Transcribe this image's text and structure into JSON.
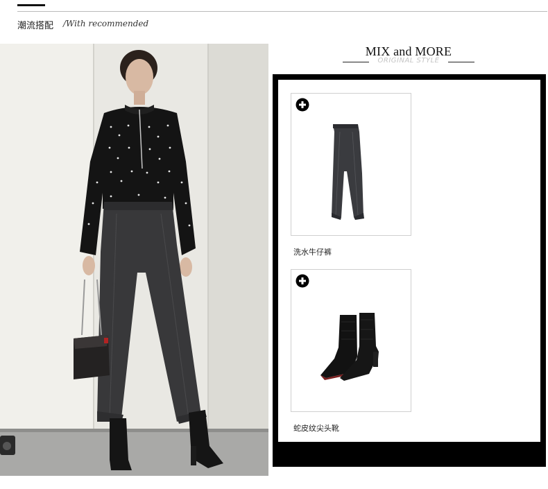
{
  "section": {
    "title": "潮流搭配",
    "subtitle": "/With recommended"
  },
  "mix": {
    "title": "MIX and MORE",
    "subtitle": "ORIGINAL STYLE"
  },
  "products": [
    {
      "label": "洗水牛仔裤",
      "icon": "plus-circle-icon"
    },
    {
      "label": "蛇皮纹尖头靴",
      "icon": "plus-circle-icon"
    }
  ],
  "colors": {
    "frame": "#000000",
    "text": "#222222",
    "subtitle_gray": "#c4c4c4"
  }
}
